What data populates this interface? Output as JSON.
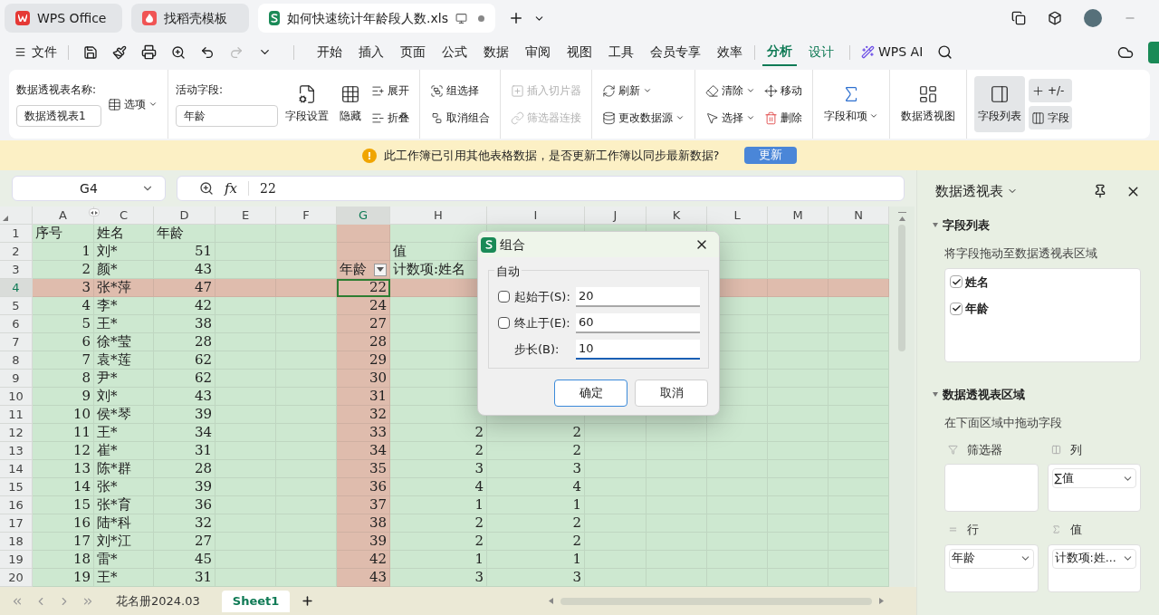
{
  "title_tabs": [
    {
      "label": "WPS Office",
      "kind": "wps",
      "selected": false
    },
    {
      "label": "找稻壳模板",
      "kind": "docer",
      "selected": false
    },
    {
      "label": "如何快速统计年龄段人数.xls",
      "kind": "sheet",
      "selected": true
    }
  ],
  "menu": {
    "file": "文件",
    "tabs": [
      {
        "label": "开始",
        "kind": "normal",
        "selected": false
      },
      {
        "label": "插入",
        "kind": "normal",
        "selected": false
      },
      {
        "label": "页面",
        "kind": "normal",
        "selected": false
      },
      {
        "label": "公式",
        "kind": "normal",
        "selected": false
      },
      {
        "label": "数据",
        "kind": "normal",
        "selected": false
      },
      {
        "label": "审阅",
        "kind": "normal",
        "selected": false
      },
      {
        "label": "视图",
        "kind": "normal",
        "selected": false
      },
      {
        "label": "工具",
        "kind": "normal",
        "selected": false
      },
      {
        "label": "会员专享",
        "kind": "normal",
        "selected": false
      },
      {
        "label": "效率",
        "kind": "normal",
        "selected": false
      },
      {
        "label": "分析",
        "kind": "context",
        "selected": true
      },
      {
        "label": "设计",
        "kind": "context",
        "selected": false
      }
    ],
    "ai": "WPS AI"
  },
  "ribbon": [
    {
      "caption": "数据透视表名称:",
      "field": "数据透视表1",
      "buttons": [
        {
          "label": "选项",
          "kind": "small",
          "menu": true,
          "disabled": false,
          "pressed": false
        }
      ]
    },
    {
      "caption": "活动字段:",
      "field": "年龄",
      "buttons": [
        {
          "label": "字段设置",
          "kind": "large",
          "menu": false,
          "disabled": false,
          "pressed": false
        },
        {
          "label": "隐藏",
          "kind": "large",
          "menu": false,
          "disabled": false,
          "pressed": false
        },
        {
          "label": "展开",
          "kind": "small",
          "menu": false,
          "disabled": false,
          "pressed": false
        },
        {
          "label": "折叠",
          "kind": "small",
          "menu": false,
          "disabled": false,
          "pressed": false
        }
      ]
    },
    {
      "buttons": [
        {
          "label": "组选择",
          "kind": "small",
          "menu": false,
          "disabled": false,
          "pressed": false
        },
        {
          "label": "取消组合",
          "kind": "small",
          "menu": false,
          "disabled": false,
          "pressed": false
        }
      ]
    },
    {
      "buttons": [
        {
          "label": "插入切片器",
          "kind": "small",
          "menu": false,
          "disabled": true,
          "pressed": false
        },
        {
          "label": "筛选器连接",
          "kind": "small",
          "menu": false,
          "disabled": true,
          "pressed": false
        }
      ]
    },
    {
      "buttons": [
        {
          "label": "刷新",
          "kind": "small",
          "menu": true,
          "disabled": false,
          "pressed": false
        },
        {
          "label": "更改数据源",
          "kind": "small",
          "menu": true,
          "disabled": false,
          "pressed": false
        }
      ]
    },
    {
      "buttons": [
        {
          "label": "清除",
          "kind": "small",
          "menu": true,
          "disabled": false,
          "pressed": false
        },
        {
          "label": "选择",
          "kind": "small",
          "menu": true,
          "disabled": false,
          "pressed": false
        },
        {
          "label": "移动",
          "kind": "small",
          "menu": false,
          "disabled": false,
          "pressed": false
        },
        {
          "label": "删除",
          "kind": "small",
          "menu": false,
          "disabled": false,
          "pressed": false
        }
      ]
    },
    {
      "buttons": [
        {
          "label": "字段和项",
          "kind": "large",
          "menu": true,
          "disabled": false,
          "pressed": false
        }
      ]
    },
    {
      "buttons": [
        {
          "label": "数据透视图",
          "kind": "large",
          "menu": false,
          "disabled": false,
          "pressed": false
        }
      ]
    },
    {
      "buttons": [
        {
          "label": "字段列表",
          "kind": "large",
          "menu": false,
          "disabled": false,
          "pressed": true
        },
        {
          "label": "+/-",
          "kind": "small",
          "menu": false,
          "disabled": false,
          "pressed": true
        },
        {
          "label": "字段",
          "kind": "small",
          "menu": false,
          "disabled": false,
          "pressed": true
        }
      ]
    }
  ],
  "notice": {
    "text": "此工作簿已引用其他表格数据，是否更新工作簿以同步最新数据?",
    "button": "更新"
  },
  "formula_bar": {
    "name_box": "G4",
    "function_label": "fx",
    "value": "22"
  },
  "sheet": {
    "columns": [
      {
        "letter": "A",
        "selected": false
      },
      {
        "letter": "C",
        "selected": false
      },
      {
        "letter": "D",
        "selected": false
      },
      {
        "letter": "E",
        "selected": false
      },
      {
        "letter": "F",
        "selected": false
      },
      {
        "letter": "G",
        "selected": true
      },
      {
        "letter": "H",
        "selected": false
      },
      {
        "letter": "I",
        "selected": false
      },
      {
        "letter": "J",
        "selected": false
      },
      {
        "letter": "K",
        "selected": false
      },
      {
        "letter": "L",
        "selected": false
      },
      {
        "letter": "M",
        "selected": false
      },
      {
        "letter": "N",
        "selected": false
      }
    ],
    "rows": [
      {
        "number": "1",
        "selected": false,
        "cells": {
          "A": "序号",
          "C": "姓名",
          "D": "年龄"
        }
      },
      {
        "number": "2",
        "selected": false,
        "cells": {
          "A": "1",
          "C": "刘*",
          "D": "51",
          "H": "值"
        }
      },
      {
        "number": "3",
        "selected": false,
        "cells": {
          "A": "2",
          "C": "颜*",
          "D": "43",
          "G": {
            "text": "年龄",
            "filter_button": true
          },
          "H": "计数项:姓名"
        }
      },
      {
        "number": "4",
        "selected": true,
        "cells": {
          "A": "3",
          "C": "张*萍",
          "D": "47",
          "G": "22"
        }
      },
      {
        "number": "5",
        "selected": false,
        "cells": {
          "A": "4",
          "C": "李*",
          "D": "42",
          "G": "24"
        }
      },
      {
        "number": "6",
        "selected": false,
        "cells": {
          "A": "5",
          "C": "王*",
          "D": "38",
          "G": "27"
        }
      },
      {
        "number": "7",
        "selected": false,
        "cells": {
          "A": "6",
          "C": "徐*莹",
          "D": "28",
          "G": "28"
        }
      },
      {
        "number": "8",
        "selected": false,
        "cells": {
          "A": "7",
          "C": "袁*莲",
          "D": "62",
          "G": "29"
        }
      },
      {
        "number": "9",
        "selected": false,
        "cells": {
          "A": "8",
          "C": "尹*",
          "D": "62",
          "G": "30"
        }
      },
      {
        "number": "10",
        "selected": false,
        "cells": {
          "A": "9",
          "C": "刘*",
          "D": "43",
          "G": "31"
        }
      },
      {
        "number": "11",
        "selected": false,
        "cells": {
          "A": "10",
          "C": "侯*琴",
          "D": "39",
          "G": "32"
        }
      },
      {
        "number": "12",
        "selected": false,
        "cells": {
          "A": "11",
          "C": "王*",
          "D": "34",
          "G": "33",
          "H": "2",
          "I": "2"
        }
      },
      {
        "number": "13",
        "selected": false,
        "cells": {
          "A": "12",
          "C": "崔*",
          "D": "31",
          "G": "34",
          "H": "2",
          "I": "2"
        }
      },
      {
        "number": "14",
        "selected": false,
        "cells": {
          "A": "13",
          "C": "陈*群",
          "D": "28",
          "G": "35",
          "H": "3",
          "I": "3"
        }
      },
      {
        "number": "15",
        "selected": false,
        "cells": {
          "A": "14",
          "C": "张*",
          "D": "39",
          "G": "36",
          "H": "4",
          "I": "4"
        }
      },
      {
        "number": "16",
        "selected": false,
        "cells": {
          "A": "15",
          "C": "张*育",
          "D": "36",
          "G": "37",
          "H": "1",
          "I": "1"
        }
      },
      {
        "number": "17",
        "selected": false,
        "cells": {
          "A": "16",
          "C": "陆*科",
          "D": "32",
          "G": "38",
          "H": "2",
          "I": "2"
        }
      },
      {
        "number": "18",
        "selected": false,
        "cells": {
          "A": "17",
          "C": "刘*江",
          "D": "27",
          "G": "39",
          "H": "2",
          "I": "2"
        }
      },
      {
        "number": "19",
        "selected": false,
        "cells": {
          "A": "18",
          "C": "雷*",
          "D": "45",
          "G": "42",
          "H": "1",
          "I": "1"
        }
      },
      {
        "number": "20",
        "selected": false,
        "cells": {
          "A": "19",
          "C": "王*",
          "D": "31",
          "G": "43",
          "H": "3",
          "I": "3"
        }
      }
    ]
  },
  "sheet_tabs": [
    {
      "label": "花名册2024.03",
      "selected": false
    },
    {
      "label": "Sheet1",
      "selected": true
    }
  ],
  "dialog": {
    "title": "组合",
    "group": "自动",
    "fields": [
      {
        "kind": "checkbox",
        "label": "起始于(S):",
        "value": "20",
        "checked": false,
        "focused": false
      },
      {
        "kind": "checkbox",
        "label": "终止于(E):",
        "value": "60",
        "checked": false,
        "focused": false
      },
      {
        "kind": "plain",
        "label": "步长(B):",
        "value": "10",
        "focused": true
      }
    ],
    "buttons": [
      {
        "label": "确定",
        "default": true
      },
      {
        "label": "取消",
        "default": false
      }
    ]
  },
  "pane": {
    "title": "数据透视表",
    "sections": [
      {
        "title": "字段列表",
        "expanded": true,
        "hint": "将字段拖动至数据透视表区域"
      },
      {
        "title": "数据透视表区域",
        "expanded": true,
        "hint": "在下面区域中拖动字段"
      }
    ],
    "fields": [
      {
        "label": "姓名",
        "checked": true
      },
      {
        "label": "年龄",
        "checked": true
      }
    ],
    "areas": [
      {
        "kind": "filter",
        "label": "筛选器"
      },
      {
        "kind": "columns",
        "label": "列",
        "items": [
          "∑值"
        ]
      },
      {
        "kind": "rows",
        "label": "行",
        "items": [
          "年龄"
        ]
      },
      {
        "kind": "values",
        "label": "值",
        "items": [
          "计数项:姓..."
        ]
      }
    ]
  }
}
